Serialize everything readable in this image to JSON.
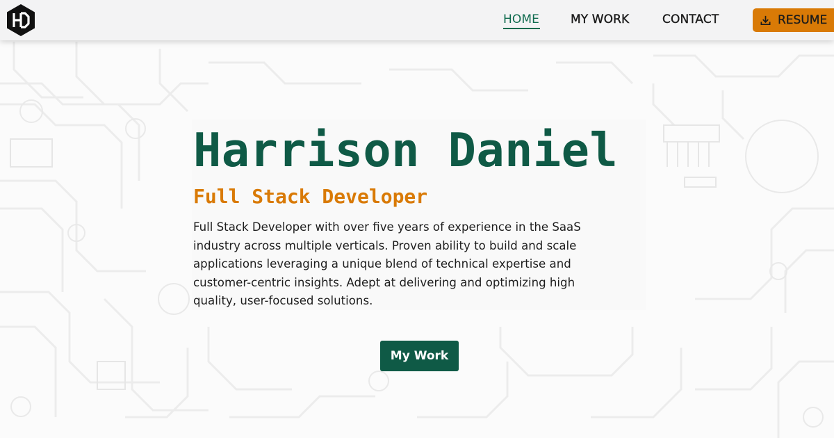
{
  "header": {
    "logo_icon": "hd-hexagon-logo-icon",
    "nav": [
      {
        "label": "HOME",
        "active": true
      },
      {
        "label": "MY WORK",
        "active": false
      },
      {
        "label": "CONTACT",
        "active": false
      }
    ],
    "resume": {
      "label": "RESUME",
      "icon": "download-icon"
    }
  },
  "hero": {
    "name": "Harrison Daniel",
    "role": "Full Stack Developer",
    "description": "Full Stack Developer with over five years of experience in the SaaS industry across multiple verticals. Proven ability to build and scale applications leveraging a unique blend of technical expertise and customer-centric insights. Adept at delivering and optimizing high quality, user-focused solutions.",
    "cta_label": "My Work"
  },
  "colors": {
    "accent_green": "#0f5a46",
    "accent_orange": "#d97a06",
    "header_bg": "#f3f3f4",
    "page_bg": "#fbfbfb"
  }
}
